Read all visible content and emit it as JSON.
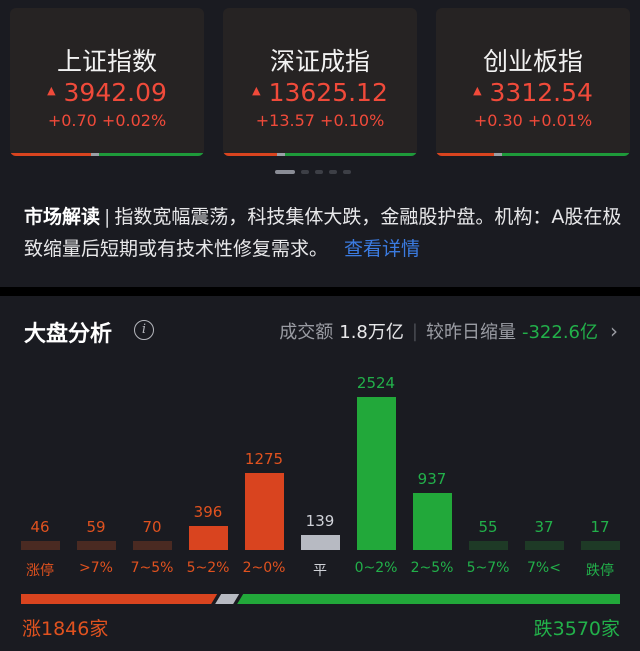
{
  "indices": [
    {
      "name": "上证指数",
      "price": "3942.09",
      "change": "+0.70 +0.02%"
    },
    {
      "name": "深证成指",
      "price": "13625.12",
      "change": "+13.57 +0.10%"
    },
    {
      "name": "创业板指",
      "price": "3312.54",
      "change": "+0.30 +0.01%"
    }
  ],
  "market_read": {
    "tag": "市场解读",
    "separator": "|",
    "text": "指数宽幅震荡，科技集体大跌，金融股护盘。机构：A股在极致缩量后短期或有技术性修复需求。",
    "link": "查看详情"
  },
  "analysis": {
    "title": "大盘分析",
    "info_icon": "info-icon",
    "volume_label": "成交额",
    "volume_value": "1.8万亿",
    "compare_label": "较昨日缩量",
    "compare_value": "-322.6亿",
    "chevron": "›"
  },
  "chart_data": {
    "type": "bar",
    "categories": [
      "涨停",
      ">7%",
      "7~5%",
      "5~2%",
      "2~0%",
      "平",
      "0~2%",
      "2~5%",
      "5~7%",
      "7%<",
      "跌停"
    ],
    "values": [
      46,
      59,
      70,
      396,
      1275,
      139,
      2524,
      937,
      55,
      37,
      17
    ],
    "title": "",
    "xlabel": "",
    "ylabel": ""
  },
  "summary": {
    "up_label": "涨1846家",
    "down_label": "跌3570家",
    "up_count": 1846,
    "down_count": 3570
  },
  "colors": {
    "up": "#d9441f",
    "up_text": "#e0521f",
    "flat": "#b7bac2",
    "down": "#22a83a",
    "down_text": "#22b04a",
    "dim_up": "#4a2a22",
    "dim_down": "#1e3a26"
  }
}
